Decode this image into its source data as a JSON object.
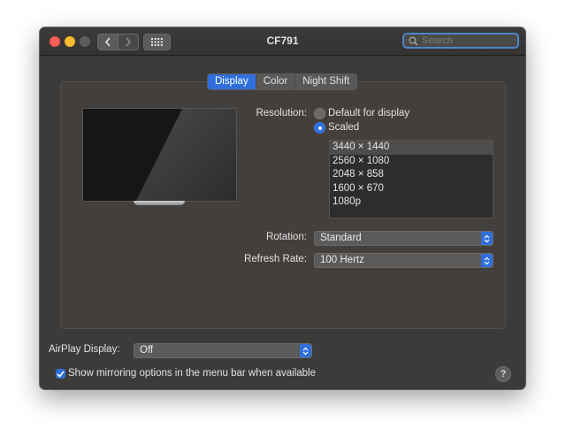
{
  "window": {
    "title": "CF791"
  },
  "search": {
    "placeholder": "Search"
  },
  "tabs": [
    {
      "label": "Display",
      "active": true
    },
    {
      "label": "Color",
      "active": false
    },
    {
      "label": "Night Shift",
      "active": false
    }
  ],
  "resolution": {
    "label": "Resolution:",
    "options": [
      {
        "label": "Default for display",
        "selected": false
      },
      {
        "label": "Scaled",
        "selected": true
      }
    ],
    "scaled_list": [
      "3440 × 1440",
      "2560 × 1080",
      "2048 × 858",
      "1600 × 670",
      "1080p"
    ],
    "selected_index": 0
  },
  "rotation": {
    "label": "Rotation:",
    "value": "Standard"
  },
  "refresh_rate": {
    "label": "Refresh Rate:",
    "value": "100 Hertz"
  },
  "airplay": {
    "label": "AirPlay Display:",
    "value": "Off"
  },
  "mirroring": {
    "label": "Show mirroring options in the menu bar when available",
    "checked": true
  },
  "help": {
    "label": "?"
  },
  "colors": {
    "accent": "#2f6fdc",
    "window_bg": "#3d3b39"
  }
}
